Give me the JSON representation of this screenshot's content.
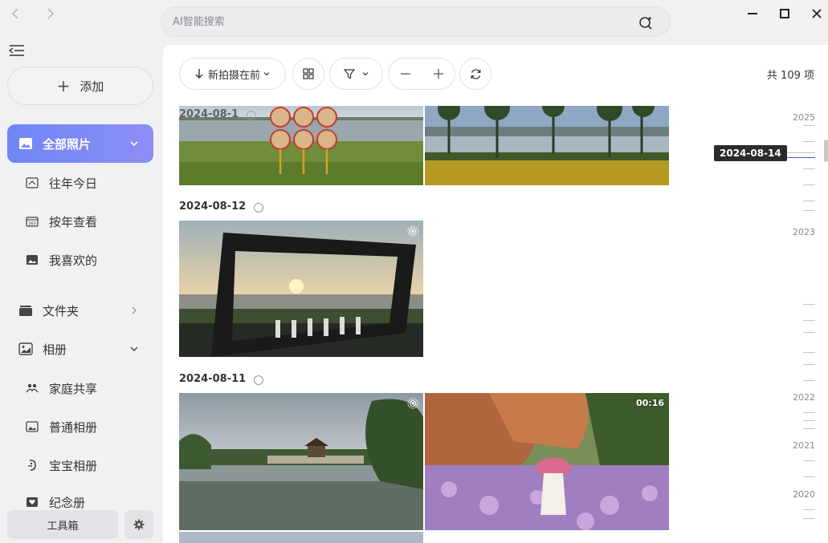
{
  "nav": {
    "back_icon": "chevron-left-icon",
    "forward_icon": "chevron-right-icon"
  },
  "search": {
    "placeholder": "AI智能搜索"
  },
  "sidebar": {
    "add_label": "添加",
    "items": [
      {
        "label": "全部照片",
        "icon": "photos-icon"
      },
      {
        "label": "往年今日",
        "icon": "history-icon"
      },
      {
        "label": "按年查看",
        "icon": "calendar-year-icon"
      },
      {
        "label": "我喜欢的",
        "icon": "favorite-image-icon"
      },
      {
        "label": "文件夹",
        "icon": "folder-icon"
      },
      {
        "label": "相册",
        "icon": "album-icon"
      },
      {
        "label": "家庭共享",
        "icon": "family-share-icon"
      },
      {
        "label": "普通相册",
        "icon": "normal-album-icon"
      },
      {
        "label": "宝宝相册",
        "icon": "baby-album-icon"
      },
      {
        "label": "纪念册",
        "icon": "memorial-icon"
      }
    ],
    "toolbox_label": "工具箱"
  },
  "toolbar": {
    "sort_label": "新拍摄在前",
    "count_label": "共 109 项"
  },
  "groups": [
    {
      "date": "2024-08-1"
    },
    {
      "date": "2024-08-12"
    },
    {
      "date": "2024-08-11"
    }
  ],
  "video": {
    "duration": "00:16"
  },
  "timeline": {
    "years": [
      "2025",
      "2023",
      "2022",
      "2021",
      "2020"
    ],
    "current": "2024-08-14"
  },
  "colors": {
    "accent": "#7b8af6",
    "active_start": "#6e86f6",
    "active_end": "#8d8ef6"
  }
}
